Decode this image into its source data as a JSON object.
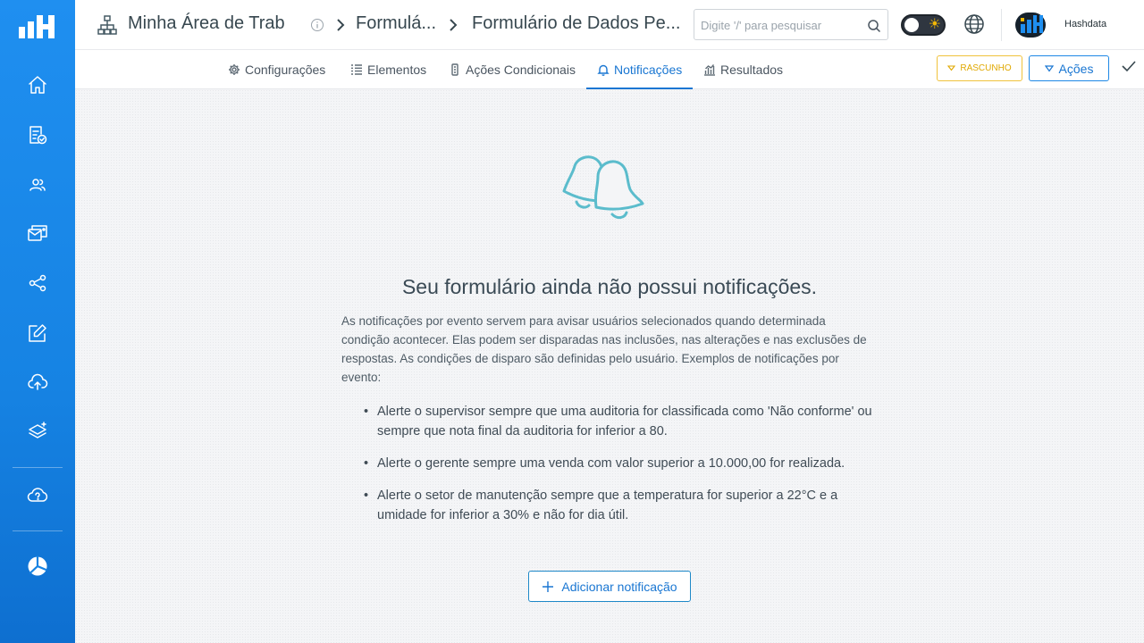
{
  "header": {
    "breadcrumbs": [
      "Minha Área de Trab",
      "Formulá...",
      "Formulário de Dados Pe..."
    ],
    "search_placeholder": "Digite '/' para pesquisar",
    "user_name": "Hashdata"
  },
  "tabs": [
    {
      "label": "Configurações",
      "icon": "gear-icon"
    },
    {
      "label": "Elementos",
      "icon": "list-icon"
    },
    {
      "label": "Ações Condicionais",
      "icon": "conditional-icon"
    },
    {
      "label": "Notificações",
      "icon": "bell-icon",
      "active": true
    },
    {
      "label": "Resultados",
      "icon": "chart-icon"
    }
  ],
  "toolbar": {
    "draft_label": "RASCUNHO",
    "actions_label": "Ações"
  },
  "empty_state": {
    "title": "Seu formulário ainda não possui notificações.",
    "description": "As notificações por evento servem para avisar usuários selecionados quando determinada condição acontecer. Elas podem ser disparadas nas inclusões, nas alterações e nas exclusões de respostas. As condições de disparo são definidas pelo usuário. Exemplos de notificações por evento:",
    "examples": [
      "Alerte o supervisor sempre que uma auditoria for classificada como 'Não conforme' ou sempre que nota final da auditoria for inferior a 80.",
      "Alerte o gerente sempre uma venda com valor superior a 10.000,00 for realizada.",
      "Alerte o setor de manutenção sempre que a temperatura for superior a 22°C e a umidade for inferior a 30% e não for dia útil."
    ],
    "add_button_label": "Adicionar notificação"
  },
  "colors": {
    "sidebar": "#1683e3",
    "accent": "#1976d2",
    "draft": "#e0a800",
    "bell_illustration": "#5bbccc"
  }
}
